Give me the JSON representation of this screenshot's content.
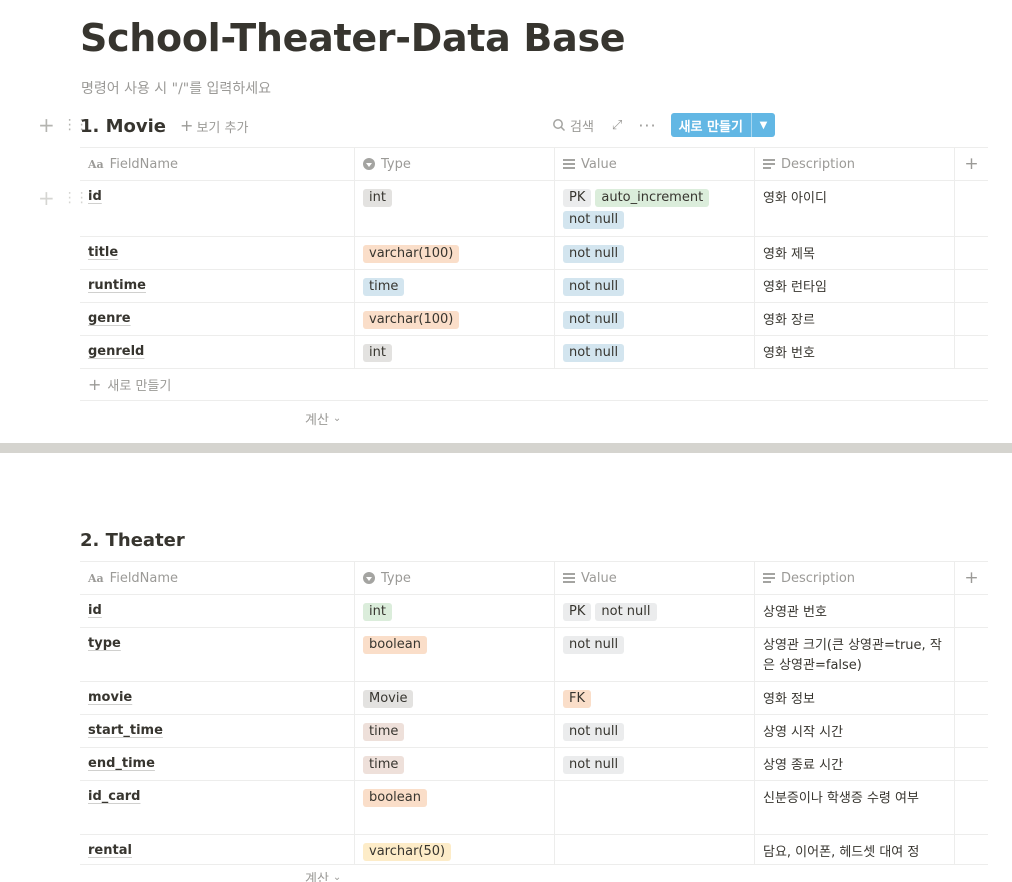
{
  "page": {
    "title": "School-Theater-Data Base",
    "hint": "명령어 사용 시 \"/\"를 입력하세요"
  },
  "toolbar": {
    "search_label": "검색",
    "new_label": "새로 만들기"
  },
  "columns": {
    "fieldname": "FieldName",
    "type": "Type",
    "value": "Value",
    "description": "Description"
  },
  "movie": {
    "title": "1. Movie",
    "add_view": "보기 추가",
    "new_row": "새로 만들기",
    "calc": "계산",
    "rows": [
      {
        "name": "id",
        "type": "int",
        "values": [
          "PK",
          "auto_increment",
          "not null"
        ],
        "desc": "영화 아이디"
      },
      {
        "name": "title",
        "type": "varchar(100)",
        "values": [
          "not null"
        ],
        "desc": "영화 제목"
      },
      {
        "name": "runtime",
        "type": "time",
        "values": [
          "not null"
        ],
        "desc": "영화 런타임"
      },
      {
        "name": "genre",
        "type": "varchar(100)",
        "values": [
          "not null"
        ],
        "desc": "영화 장르"
      },
      {
        "name": "genreld",
        "type": "int",
        "values": [
          "not null"
        ],
        "desc": "영화 번호"
      }
    ]
  },
  "theater": {
    "title": "2. Theater",
    "calc": "계산",
    "rows": [
      {
        "name": "id",
        "type": "int",
        "values": [
          "PK",
          "not null"
        ],
        "desc": "상영관 번호"
      },
      {
        "name": "type",
        "type": "boolean",
        "values": [
          "not null"
        ],
        "desc": "상영관 크기(큰 상영관=true, 작은 상영관=false)"
      },
      {
        "name": "movie",
        "type": "Movie",
        "values": [
          "FK"
        ],
        "desc": "영화 정보"
      },
      {
        "name": "start_time",
        "type": "time",
        "values": [
          "not null"
        ],
        "desc": "상영 시작 시간"
      },
      {
        "name": "end_time",
        "type": "time",
        "values": [
          "not null"
        ],
        "desc": "상영 종료 시간"
      },
      {
        "name": "id_card",
        "type": "boolean",
        "values": [],
        "desc": "신분증이나  학생증 수령 여부"
      },
      {
        "name": "rental",
        "type": "varchar(50)",
        "values": [],
        "desc": "담요, 이어폰, 헤드셋 대여 정"
      }
    ]
  },
  "colors": {
    "new_button": "#62b7e4",
    "tag_gray": "#e3e2e0",
    "tag_orange": "#fadec9",
    "tag_blue": "#d3e5ef",
    "tag_green": "#dbeddb",
    "tag_yellow": "#fdecc8",
    "tag_brown": "#eee0da"
  }
}
